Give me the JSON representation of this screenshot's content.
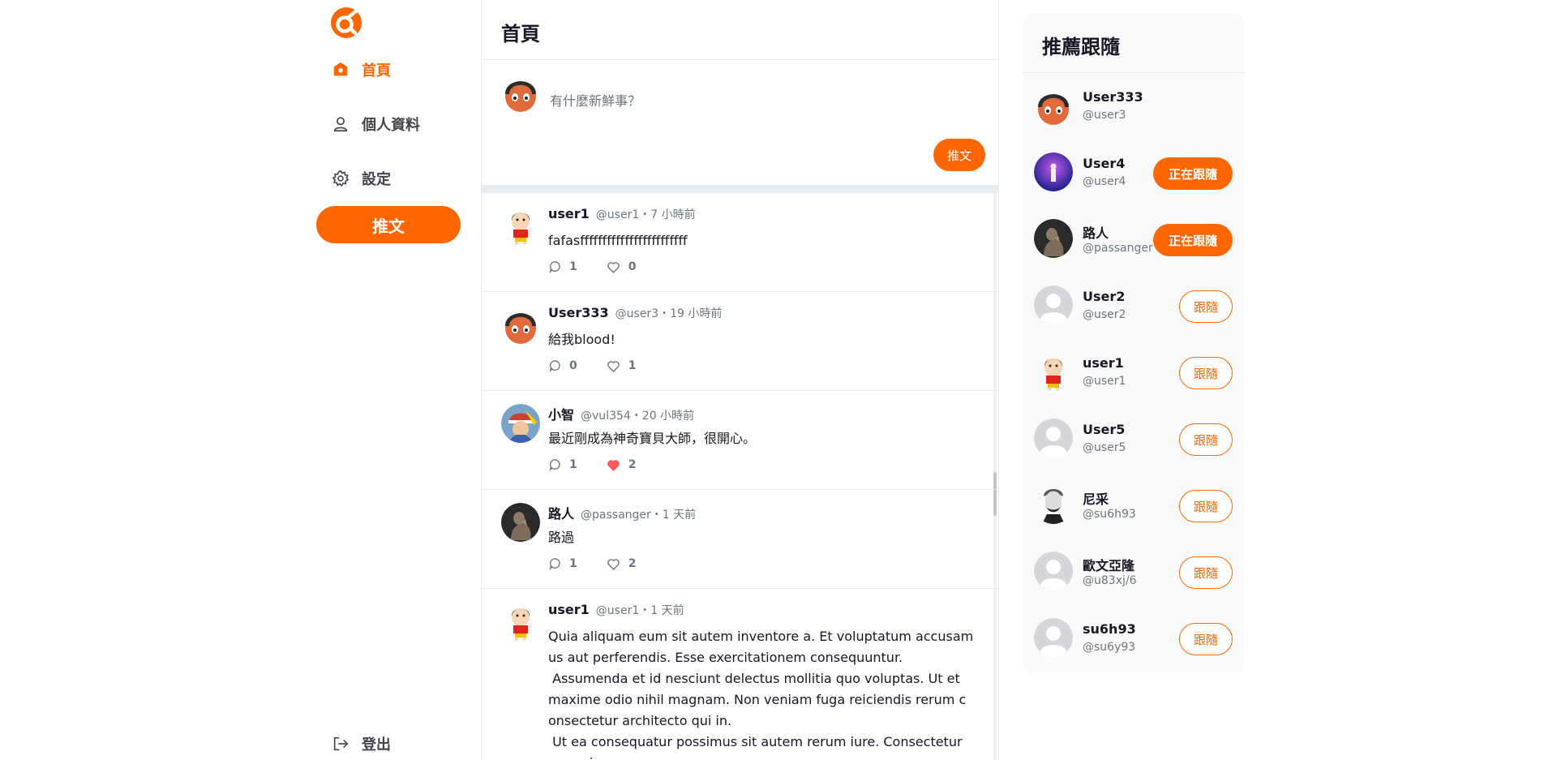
{
  "sidebar": {
    "logo": "alphitter-logo",
    "nav": [
      {
        "label": "首頁",
        "icon": "home-icon",
        "active": true
      },
      {
        "label": "個人資料",
        "icon": "user-icon",
        "active": false
      },
      {
        "label": "設定",
        "icon": "gear-icon",
        "active": false
      }
    ],
    "tweet_button": "推文",
    "logout": {
      "label": "登出",
      "icon": "logout-icon"
    }
  },
  "main": {
    "title": "首頁",
    "composer": {
      "placeholder": "有什麼新鮮事？",
      "submit_label": "推文"
    },
    "tweets": [
      {
        "name": "user1",
        "meta": "@user1・7 小時前",
        "body": "fafasffffffffffffffffffffffff",
        "replies": "1",
        "likes": "0",
        "liked": false,
        "avatar": "shinchan"
      },
      {
        "name": "User333",
        "meta": "@user3・19 小時前",
        "body": "給我blood!",
        "replies": "0",
        "likes": "1",
        "liked": false,
        "avatar": "helmet"
      },
      {
        "name": "小智",
        "meta": "@vul354・20 小時前",
        "body": "最近剛成為神奇寶貝大師，很開心。",
        "replies": "1",
        "likes": "2",
        "liked": true,
        "avatar": "ash"
      },
      {
        "name": "路人",
        "meta": "@passanger・1 天前",
        "body": "路過",
        "replies": "1",
        "likes": "2",
        "liked": false,
        "avatar": "thinker"
      },
      {
        "name": "user1",
        "meta": "@user1・1 天前",
        "body": "Quia aliquam eum sit autem inventore a. Et voluptatum accusamus aut perferendis. Esse exercitationem consequuntur.\n Assumenda et id nesciunt delectus mollitia quo voluptas. Ut et maxime odio nihil magnam. Non veniam fuga reiciendis rerum consectetur architecto qui in.\n Ut ea consequatur possimus sit autem rerum iure. Consectetur non mi",
        "replies": "",
        "likes": "",
        "liked": false,
        "avatar": "shinchan"
      }
    ]
  },
  "recommend": {
    "title": "推薦跟隨",
    "users": [
      {
        "name": "User333",
        "handle": "@user3",
        "button": "",
        "following": null,
        "avatar": "helmet"
      },
      {
        "name": "User4",
        "handle": "@user4",
        "button": "正在跟隨",
        "following": true,
        "avatar": "concert"
      },
      {
        "name": "路人",
        "handle": "@passanger",
        "button": "正在跟隨",
        "following": true,
        "avatar": "thinker"
      },
      {
        "name": "User2",
        "handle": "@user2",
        "button": "跟隨",
        "following": false,
        "avatar": "default"
      },
      {
        "name": "user1",
        "handle": "@user1",
        "button": "跟隨",
        "following": false,
        "avatar": "shinchan"
      },
      {
        "name": "User5",
        "handle": "@user5",
        "button": "跟隨",
        "following": false,
        "avatar": "default"
      },
      {
        "name": "尼采",
        "handle": "@su6h93",
        "button": "跟隨",
        "following": false,
        "avatar": "nietzsche"
      },
      {
        "name": "歐文亞隆",
        "handle": "@u83xj/6",
        "button": "跟隨",
        "following": false,
        "avatar": "default"
      },
      {
        "name": "su6h93",
        "handle": "@su6y93",
        "button": "跟隨",
        "following": false,
        "avatar": "default"
      }
    ]
  },
  "colors": {
    "brand": "#ff6600",
    "like": "#fc5a5a",
    "border": "#e6ecf0",
    "muted": "#6c757d"
  }
}
